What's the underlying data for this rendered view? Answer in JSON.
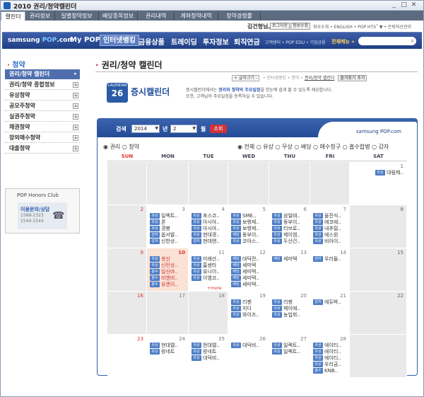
{
  "window": {
    "title": "2010 권리/청약캘린더"
  },
  "tabs": [
    "캘린더",
    "권리정보",
    "일별청약정보",
    "배당종목정보",
    "권리내역",
    "계좌청약내역",
    "청약경쟁률"
  ],
  "util": {
    "user": "김건형님,",
    "logout": "로그아웃",
    "info": "정보수정",
    "links": "회사소개 • ENGLISH • POP HTS˚ ▼ • 은퇴자산관리"
  },
  "gnb": {
    "logo_a": "samsung",
    "logo_b": "POP",
    "logo_c": ".com",
    "menus": [
      "My POP",
      "인터넷뱅킹",
      "금융상품",
      "트레이딩",
      "투자정보",
      "퇴직연금"
    ],
    "sub": "고객센터 • POP EDU • 기업금융",
    "all": "전체메뉴 »"
  },
  "left": {
    "title": "청약",
    "items": [
      "권리/청약 캘린더",
      "권리/청약 종합정보",
      "유상청약",
      "공모주청약",
      "실권주청약",
      "채권청약",
      "장외매수청약",
      "대출청약"
    ]
  },
  "honors": {
    "title": "POP Honors Club",
    "label": "이용문의/상담",
    "num1": "1588-2323",
    "num2": "1544-1544"
  },
  "page": {
    "title": "권리/청약 캘린더",
    "crumb_btn": "+ 글자크기 -",
    "crumb": "• 인터넷뱅킹 • 청약 •",
    "crumb_cur": "권리/청약 캘린더",
    "fav": "즐겨찾기 추가"
  },
  "banner": {
    "mini1": "CALENDAR",
    "daynum": "26",
    "title": "증시캘린더",
    "desc1_a": "증시캘린더에서는 ",
    "desc1_b": "권리와 청약의 주요일정",
    "desc1_c": "을 한눈에 쉽게 볼 수 있도록 제공합니다.",
    "desc2": "또한, 고객님의 주요일정을 등록하실 수 있습니다."
  },
  "search": {
    "label": "검색",
    "year": "2014",
    "year_unit": "년",
    "month": "2",
    "month_unit": "월",
    "btn": "조회",
    "brand": "samsung POP.com"
  },
  "filters": {
    "left": "◉ 권리  ○ 청약",
    "right": "◉ 전체 ○ 유상 ○ 무상 ○ 배당 ○ 매수청구 ○ 흡수합병 ○ 감자"
  },
  "dow": [
    "SUN",
    "MON",
    "TUE",
    "WED",
    "THU",
    "FRI",
    "SAT"
  ],
  "calendar": [
    [
      {
        "d": "",
        "g": true
      },
      {
        "d": "",
        "g": true
      },
      {
        "d": "",
        "g": true
      },
      {
        "d": "",
        "g": true
      },
      {
        "d": "",
        "g": true
      },
      {
        "d": "",
        "g": true
      },
      {
        "d": "1",
        "ev": [
          [
            "유상",
            "대림제.."
          ]
        ]
      }
    ],
    [
      {
        "d": "2",
        "g": true
      },
      {
        "d": "3",
        "ev": [
          [
            "유상",
            "일렉트.."
          ],
          [
            "유상",
            "폰"
          ],
          [
            "유상",
            "경봉"
          ],
          [
            "감자",
            "옵서발.."
          ],
          [
            "감자",
            "신한상.."
          ]
        ]
      },
      {
        "d": "4",
        "ev": [
          [
            "유상",
            "포스코.."
          ],
          [
            "유상",
            "아시아.."
          ],
          [
            "유상",
            "아시아.."
          ],
          [
            "유상",
            "현대경.."
          ],
          [
            "감자",
            "현대엔.."
          ]
        ]
      },
      {
        "d": "5",
        "ev": [
          [
            "유상",
            "SME.."
          ],
          [
            "유상",
            "보령제.."
          ],
          [
            "유상",
            "보령제.."
          ],
          [
            "배당",
            "동부이.."
          ],
          [
            "유상",
            "코아스.."
          ]
        ]
      },
      {
        "d": "6",
        "ev": [
          [
            "유상",
            "삼일테.."
          ],
          [
            "유상",
            "동부이.."
          ],
          [
            "유상",
            "티브로.."
          ],
          [
            "유상",
            "제이엠.."
          ],
          [
            "유상",
            "두산건.."
          ]
        ]
      },
      {
        "d": "7",
        "ev": [
          [
            "유상",
            "울진식.."
          ],
          [
            "유상",
            "에코에.."
          ],
          [
            "유상",
            "내추럴.."
          ],
          [
            "유상",
            "에스원"
          ],
          [
            "유상",
            "비아이.."
          ]
        ]
      },
      {
        "d": "8",
        "g": true
      }
    ],
    [
      {
        "d": "9",
        "g": true
      },
      {
        "d": "10",
        "today": true,
        "ev": [
          [
            "유상",
            "쌍신"
          ],
          [
            "유상",
            "신민상.."
          ],
          [
            "흡수",
            "일신바.."
          ],
          [
            "흡수",
            "비엔비.."
          ],
          [
            "흡수",
            "유엔이.."
          ]
        ]
      },
      {
        "d": "11",
        "more": "+more",
        "ev": [
          [
            "유상",
            "미래산.."
          ],
          [
            "유상",
            "홈센타"
          ],
          [
            "유상",
            "유니이.."
          ],
          [
            "유상",
            "이엠코.."
          ]
        ]
      },
      {
        "d": "12",
        "ev": [
          [
            "배당",
            "대덕전.."
          ],
          [
            "배당",
            "세미텍"
          ],
          [
            "배당",
            "세미텍.."
          ],
          [
            "배당",
            "세미텍.."
          ],
          [
            "배당",
            "세미텍.."
          ]
        ]
      },
      {
        "d": "13",
        "ev": [
          [
            "배당",
            "세미텍"
          ]
        ]
      },
      {
        "d": "14",
        "ev": [
          [
            "감자",
            "우리들.."
          ]
        ]
      },
      {
        "d": "15",
        "g": true
      }
    ],
    [
      {
        "d": "16",
        "g": true
      },
      {
        "d": "17",
        "g": true
      },
      {
        "d": "18",
        "g": true
      },
      {
        "d": "19",
        "ev": [
          [
            "유상",
            "리젠"
          ],
          [
            "유상",
            "지디"
          ],
          [
            "유상",
            "와이즈.."
          ]
        ]
      },
      {
        "d": "20",
        "ev": [
          [
            "유상",
            "리젠"
          ],
          [
            "유상",
            "제이에.."
          ],
          [
            "유상",
            "농업회.."
          ]
        ]
      },
      {
        "d": "21",
        "ev": [
          [
            "감자",
            "에듀박.."
          ]
        ]
      },
      {
        "d": "22",
        "g": true
      }
    ],
    [
      {
        "d": "23"
      },
      {
        "d": "24",
        "ev": [
          [
            "유상",
            "현대엘.."
          ],
          [
            "유상",
            "랑네트"
          ]
        ]
      },
      {
        "d": "25",
        "ev": [
          [
            "유상",
            "현대엘.."
          ],
          [
            "유상",
            "랑네트"
          ],
          [
            "유상",
            "대덕비.."
          ]
        ]
      },
      {
        "d": "26",
        "ev": [
          [
            "유상",
            "대덕비.."
          ]
        ]
      },
      {
        "d": "27",
        "ev": [
          [
            "유상",
            "일렉트.."
          ],
          [
            "유상",
            "일렉트.."
          ]
        ]
      },
      {
        "d": "28",
        "ev": [
          [
            "유상",
            "에이티.."
          ],
          [
            "유상",
            "에이티.."
          ],
          [
            "유상",
            "에이티.."
          ],
          [
            "유상",
            "우리금.."
          ],
          [
            "흡수",
            "KNB.."
          ]
        ]
      },
      {
        "d": "",
        "g": true
      }
    ]
  ]
}
